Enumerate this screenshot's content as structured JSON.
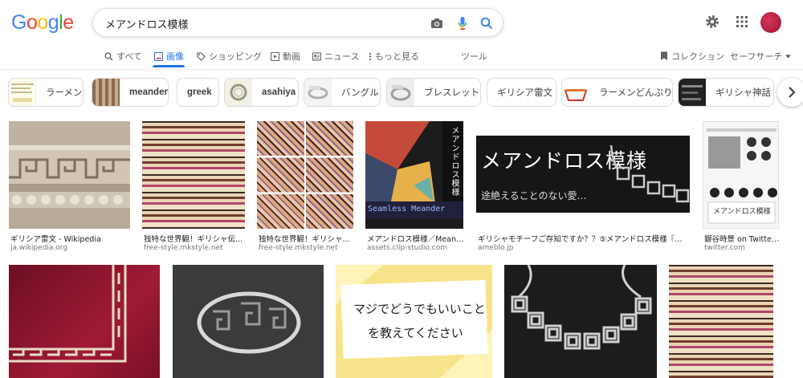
{
  "header": {
    "logo": [
      "G",
      "o",
      "o",
      "g",
      "l",
      "e"
    ],
    "logo_colors": [
      "#4285f4",
      "#ea4335",
      "#fbbc05",
      "#4285f4",
      "#34a853",
      "#ea4335"
    ],
    "query": "メアンドロス模様"
  },
  "tabs": [
    {
      "label": "すべて",
      "icon": "search-icon"
    },
    {
      "label": "画像",
      "icon": "image-icon"
    },
    {
      "label": "ショッピング",
      "icon": "tag-icon"
    },
    {
      "label": "動画",
      "icon": "play-icon"
    },
    {
      "label": "ニュース",
      "icon": "news-icon"
    },
    {
      "label": "もっと見る",
      "icon": "more-icon"
    },
    {
      "label": "ツール",
      "icon": ""
    }
  ],
  "right_tabs": {
    "collection": "コレクション",
    "safesearch": "セーフサーチ"
  },
  "chips": [
    {
      "label": "ラーメン"
    },
    {
      "label": "meander"
    },
    {
      "label": "greek"
    },
    {
      "label": "asahiya"
    },
    {
      "label": "バングル"
    },
    {
      "label": "ブレスレット"
    },
    {
      "label": "ギリシア雷文"
    },
    {
      "label": "ラーメンどんぶり"
    },
    {
      "label": "ギリシャ神話"
    }
  ],
  "results_row1": [
    {
      "title": "ギリシア雷文 - Wikipedia",
      "source": "ja.wikipedia.org"
    },
    {
      "title": "独特な世界観！ギリシャ伝...",
      "source": "free-style.mkstyle.net"
    },
    {
      "title": "独特な世界観！ギリシャ...",
      "source": "free-style.mkstyle.net"
    },
    {
      "title": "メアンドロス模様／Meand...",
      "source": "assets.clip-studio.com"
    },
    {
      "title": "ギリシャモチーフご存知ですか？？⑤メアンドロス模様『途...",
      "source": "ameblo.jp"
    },
    {
      "title": "銀谷時景 on Twitter: \"...",
      "source": "twitter.com"
    }
  ],
  "image_texts": {
    "clip_vertical": "メアンドロス模様",
    "clip_caption": "Seamless Meander",
    "ameblo_heading": "メアンドロス模様",
    "ameblo_sub": "途絶えることのない愛…",
    "twitter_caption": "メアンドロス模様",
    "yellow_line1": "マジでどうでもいいこと",
    "yellow_line2": "を教えてください"
  }
}
